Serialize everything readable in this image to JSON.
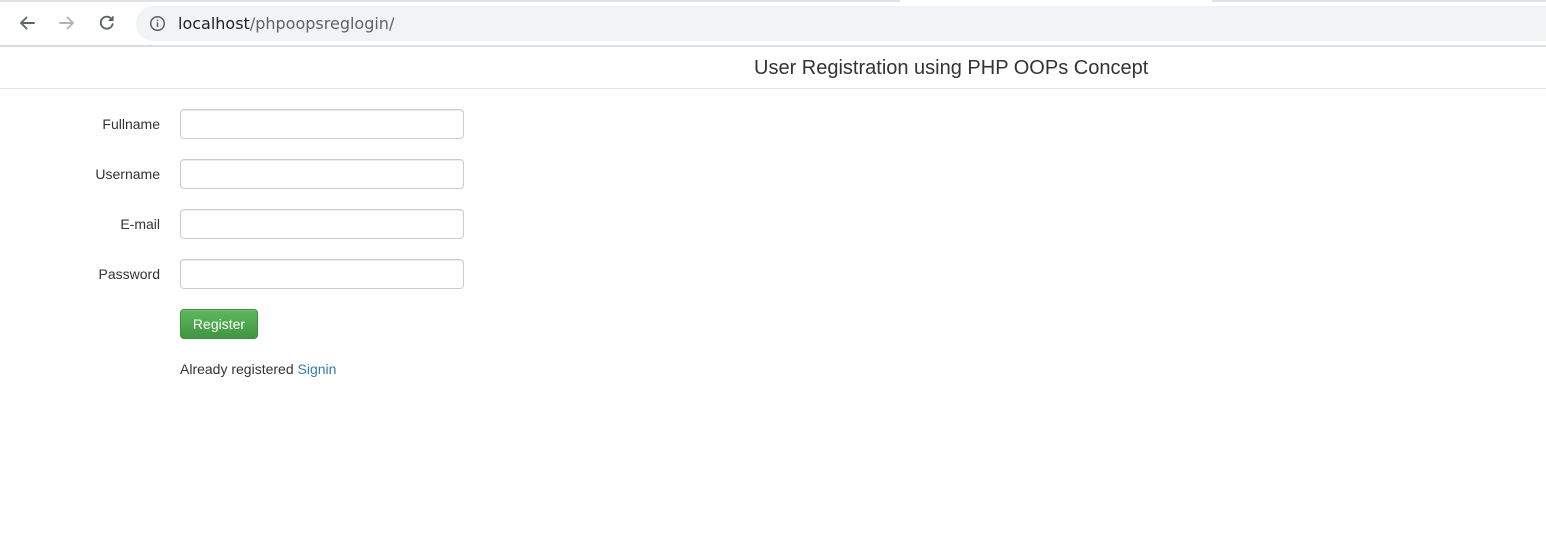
{
  "browser": {
    "url_host": "localhost",
    "url_path": "/phpoopsreglogin/",
    "icons": {
      "back": "arrow-left-icon",
      "forward": "arrow-right-icon",
      "reload": "reload-icon",
      "site_info": "info-circle-icon"
    }
  },
  "page": {
    "title": "User Registration using PHP OOPs Concept"
  },
  "form": {
    "fields": [
      {
        "label": "Fullname",
        "value": "",
        "placeholder": ""
      },
      {
        "label": "Username",
        "value": "",
        "placeholder": ""
      },
      {
        "label": "E-mail",
        "value": "",
        "placeholder": ""
      },
      {
        "label": "Password",
        "value": "",
        "placeholder": ""
      }
    ],
    "submit_label": "Register",
    "already_text": "Already registered ",
    "signin_link": "Signin"
  },
  "colors": {
    "primary_button": "#5cb85c",
    "link": "#337ab7",
    "text": "#333333"
  }
}
